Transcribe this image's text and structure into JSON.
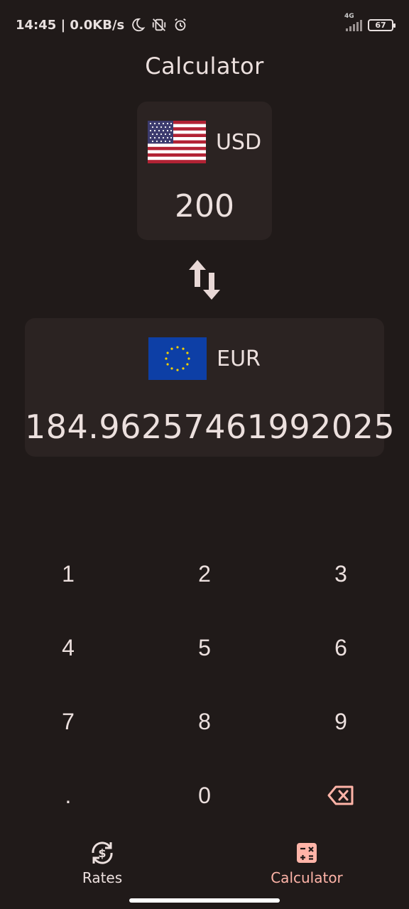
{
  "status_bar": {
    "time_speed": "14:45 | 0.0KB/s",
    "network": "4G",
    "battery": "67"
  },
  "header": {
    "title": "Calculator"
  },
  "from_currency": {
    "code": "USD",
    "flag_icon": "us-flag-icon",
    "amount": "200"
  },
  "to_currency": {
    "code": "EUR",
    "flag_icon": "eu-flag-icon",
    "amount": "184.96257461992025"
  },
  "keypad": {
    "keys": [
      "1",
      "2",
      "3",
      "4",
      "5",
      "6",
      "7",
      "8",
      "9",
      ".",
      "0"
    ],
    "backspace_icon": "backspace-icon"
  },
  "bottom_nav": {
    "items": [
      {
        "label": "Rates",
        "icon": "currency-exchange-icon",
        "active": false
      },
      {
        "label": "Calculator",
        "icon": "calculator-icon",
        "active": true
      }
    ]
  },
  "colors": {
    "background": "#201a19",
    "card": "#2b2322",
    "accent": "#ffb4a8",
    "text": "#ece0de"
  }
}
